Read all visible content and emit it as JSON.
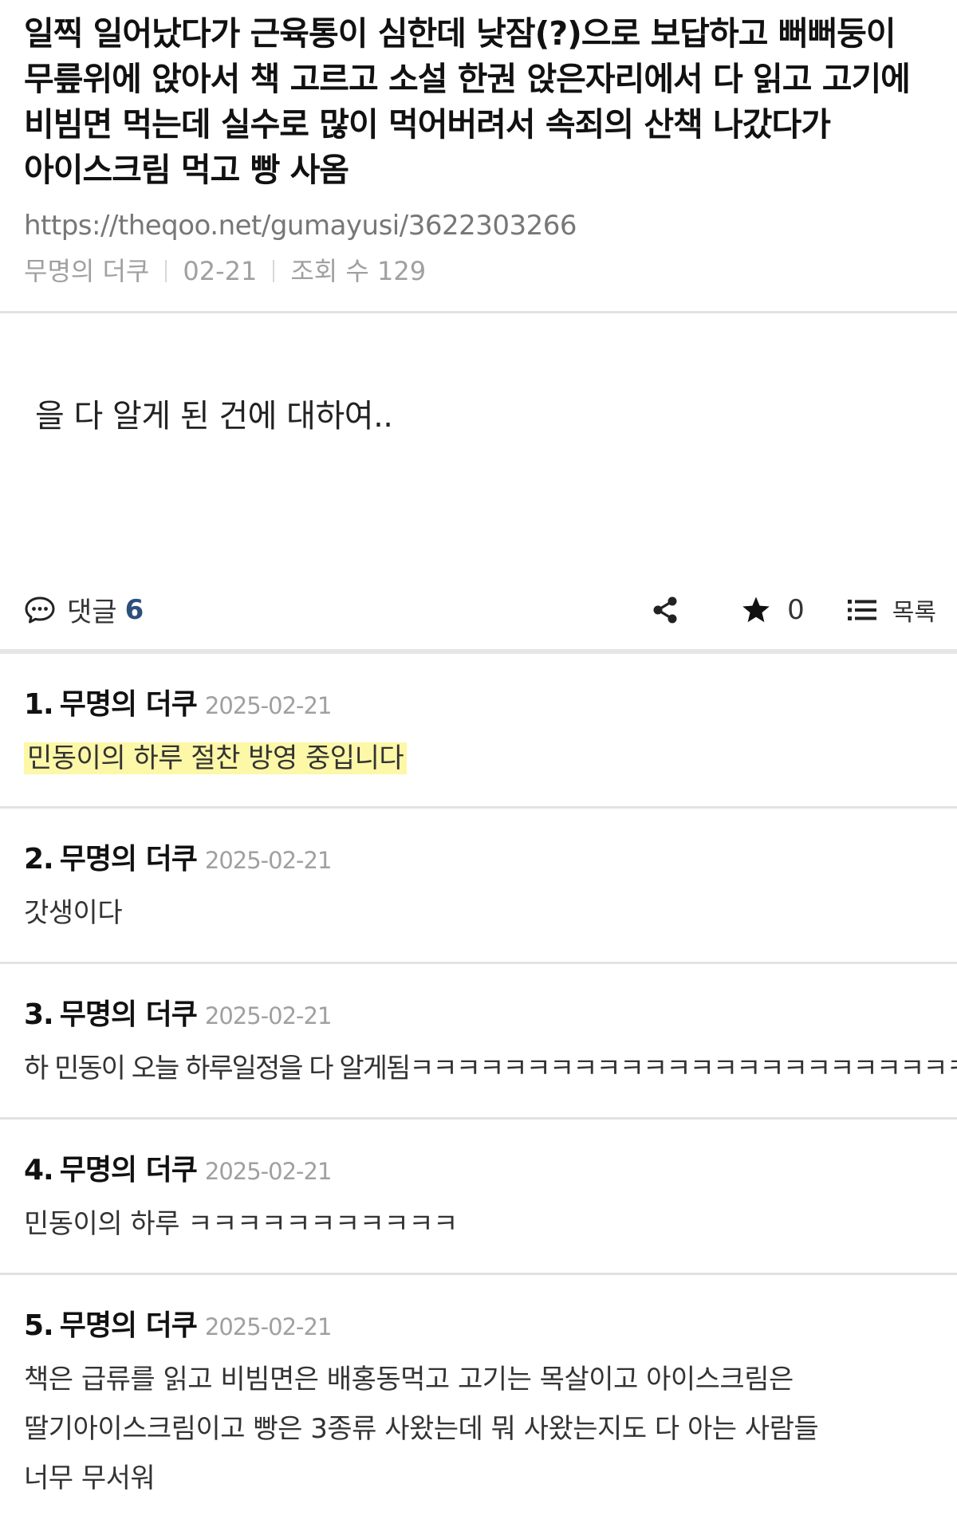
{
  "post": {
    "title": "일찍 일어났다가 근육통이 심한데 낮잠(?)으로 보답하고 뻐뻐둥이 무릎위에 앉아서 책 고르고 소설 한권 앉은자리에서 다 읽고 고기에 비빔면 먹는데 실수로 많이 먹어버려서 속죄의 산책 나갔다가 아이스크림 먹고 빵 사옴",
    "url": "https://theqoo.net/gumayusi/3622303266",
    "author": "무명의 더쿠",
    "date": "02-21",
    "views": "조회 수 129",
    "body": "을 다 알게 된 건에 대하여.."
  },
  "actions": {
    "comments_label": "댓글",
    "comments_count": "6",
    "star_count": "0",
    "list_label": "목록"
  },
  "comments": [
    {
      "num": "1.",
      "author": "무명의 더쿠",
      "date": "2025-02-21",
      "text": "민동이의 하루 절찬 방영 중입니다"
    },
    {
      "num": "2.",
      "author": "무명의 더쿠",
      "date": "2025-02-21",
      "text": "갓생이다"
    },
    {
      "num": "3.",
      "author": "무명의 더쿠",
      "date": "2025-02-21",
      "text": "하 민동이 오늘 하루일정을 다 알게됨ㅋㅋㅋㅋㅋㅋㅋㅋㅋㅋㅋㅋㅋㅋㅋㅋㅋㅋㅋㅋㅋㅋㅋㅋ"
    },
    {
      "num": "4.",
      "author": "무명의 더쿠",
      "date": "2025-02-21",
      "text": "민동이의 하루 ㅋㅋㅋㅋㅋㅋㅋㅋㅋㅋㅋ"
    },
    {
      "num": "5.",
      "author": "무명의 더쿠",
      "date": "2025-02-21",
      "text": "책은 급류를 읽고 비빔면은 배홍동먹고 고기는 목살이고 아이스크림은 딸기아이스크림이고 빵은 3종류 사왔는데 뭐 사왔는지도 다 아는 사람들",
      "text2": "너무 무서워"
    }
  ]
}
